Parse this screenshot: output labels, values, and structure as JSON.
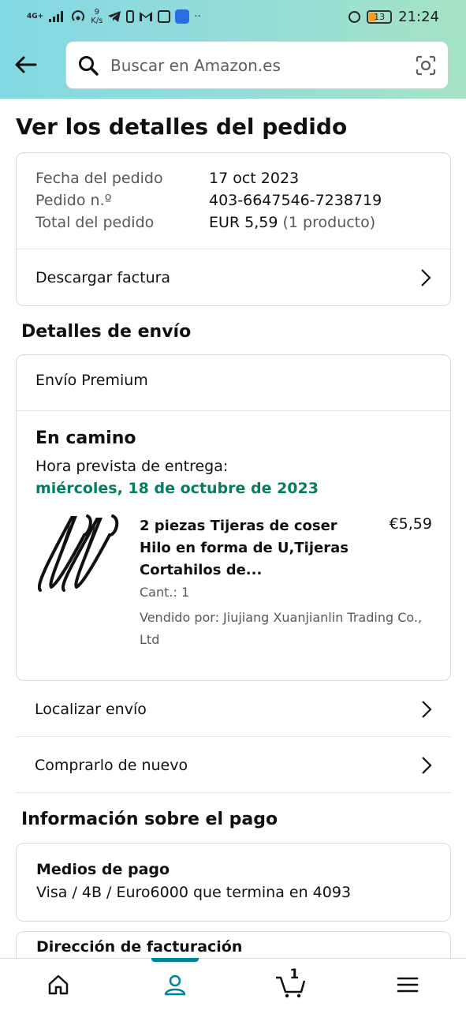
{
  "status_bar": {
    "network": "4G+",
    "speed_value": "9",
    "speed_unit": "K/s",
    "battery": "13",
    "time": "21:24"
  },
  "header": {
    "search_placeholder": "Buscar en Amazon.es"
  },
  "page_title": "Ver los detalles del pedido",
  "order_summary": {
    "date_label": "Fecha del pedido",
    "date_value": "17 oct 2023",
    "number_label": "Pedido n.º",
    "number_value": "403-6647546-7238719",
    "total_label": "Total del pedido",
    "total_value": "EUR 5,59",
    "total_items": "(1 producto)",
    "invoice_label": "Descargar factura"
  },
  "shipping": {
    "section_title": "Detalles de envío",
    "ship_type": "Envío Premium",
    "status": "En camino",
    "eta_label": "Hora prevista de entrega:",
    "eta_date": "miércoles, 18 de octubre de 2023",
    "product": {
      "title": "2 piezas Tijeras de coser Hilo en forma de U,Tijeras Cortahilos de...",
      "price": "€5,59",
      "quantity": "Cant.: 1",
      "seller": "Vendido por: Jiujiang Xuanjianlin Trading Co., Ltd"
    },
    "track_label": "Localizar envío",
    "buy_again_label": "Comprarlo de nuevo"
  },
  "payment": {
    "section_title": "Información sobre el pago",
    "method_label": "Medios de pago",
    "method_value": "Visa / 4B / Euro6000  que termina en 4093",
    "billing_label": "Dirección de facturación"
  },
  "bottom_nav": {
    "cart_count": "1"
  },
  "colors": {
    "header_gradient_start": "#82d8e3",
    "header_gradient_end": "#a5e3c4",
    "delivery_green": "#067d62",
    "nav_active": "#008296"
  }
}
